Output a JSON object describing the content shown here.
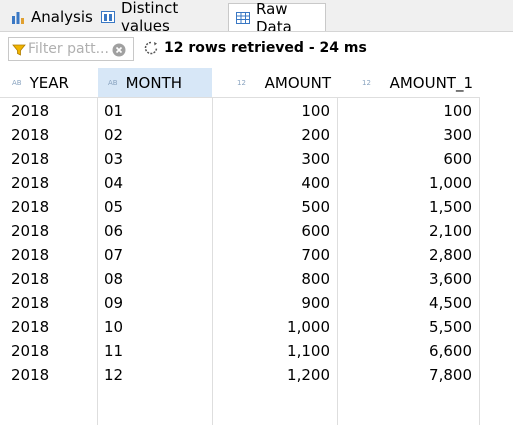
{
  "tabs": [
    {
      "label": "Analysis",
      "icon": "bar-chart-icon"
    },
    {
      "label": "Distinct values",
      "icon": "columns-icon"
    },
    {
      "label": "Raw Data",
      "icon": "table-icon",
      "active": true
    }
  ],
  "filter": {
    "placeholder": "Filter patt..."
  },
  "status": {
    "text": "12 rows retrieved - 24 ms"
  },
  "table": {
    "columns": [
      {
        "type": "AB",
        "label": "YEAR"
      },
      {
        "type": "AB",
        "label": "MONTH"
      },
      {
        "type": "12",
        "label": "AMOUNT"
      },
      {
        "type": "12",
        "label": "AMOUNT_1"
      }
    ],
    "rows": [
      [
        "2018",
        "01",
        "100",
        "100"
      ],
      [
        "2018",
        "02",
        "200",
        "300"
      ],
      [
        "2018",
        "03",
        "300",
        "600"
      ],
      [
        "2018",
        "04",
        "400",
        "1,000"
      ],
      [
        "2018",
        "05",
        "500",
        "1,500"
      ],
      [
        "2018",
        "06",
        "600",
        "2,100"
      ],
      [
        "2018",
        "07",
        "700",
        "2,800"
      ],
      [
        "2018",
        "08",
        "800",
        "3,600"
      ],
      [
        "2018",
        "09",
        "900",
        "4,500"
      ],
      [
        "2018",
        "10",
        "1,000",
        "5,500"
      ],
      [
        "2018",
        "11",
        "1,100",
        "6,600"
      ],
      [
        "2018",
        "12",
        "1,200",
        "7,800"
      ]
    ]
  }
}
